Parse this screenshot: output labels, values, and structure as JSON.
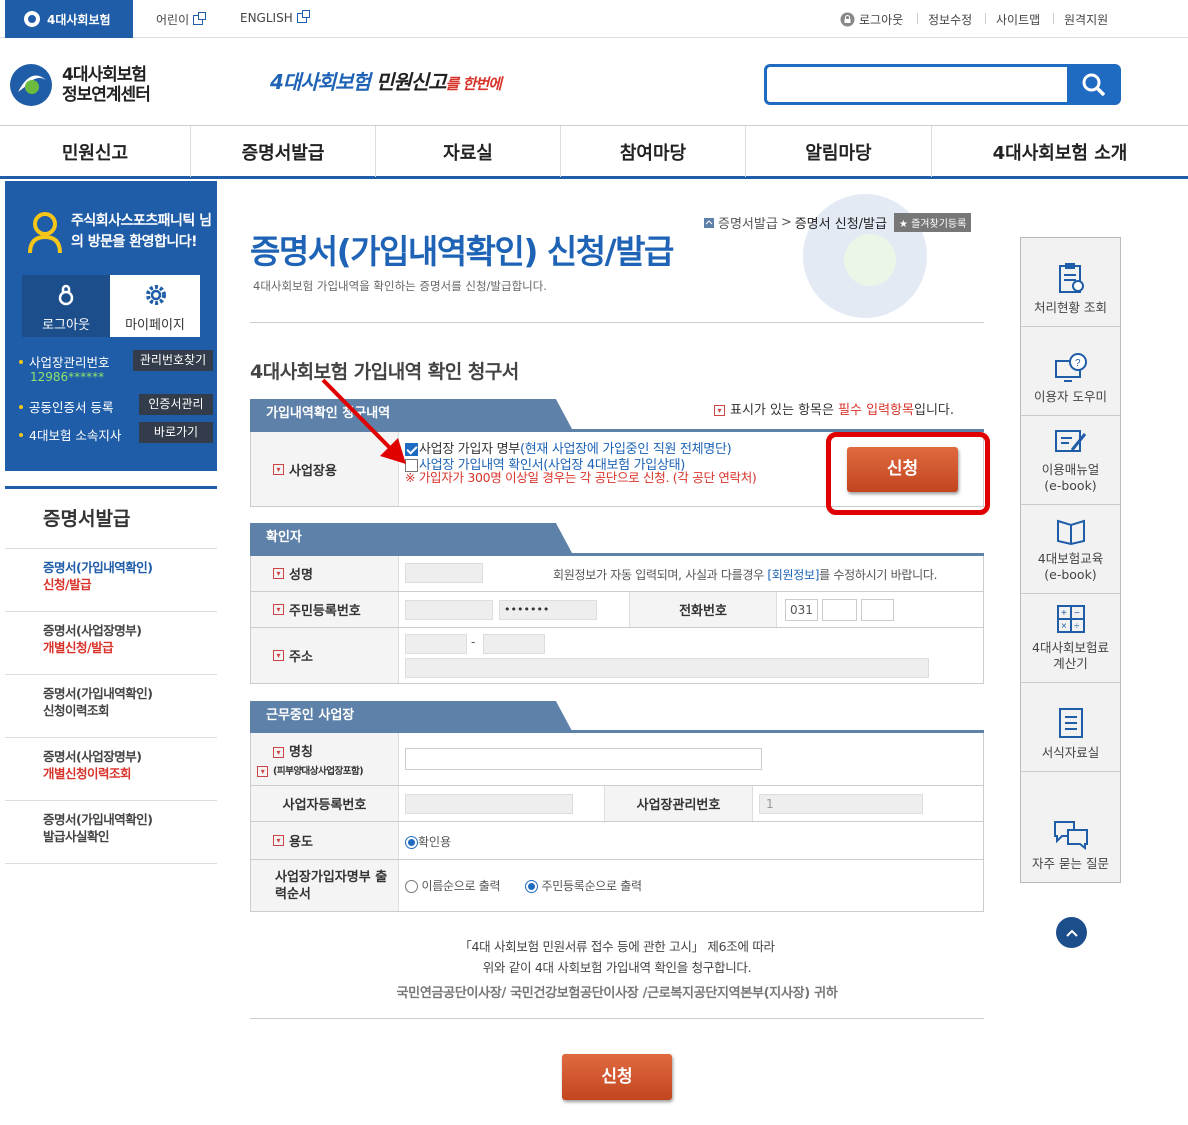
{
  "topbar": {
    "brand": "4대사회보험",
    "kids": "어린이",
    "english": "ENGLISH",
    "logout": "로그아웃",
    "edit_info": "정보수정",
    "sitemap": "사이트맵",
    "remote": "원격지원"
  },
  "header": {
    "logo_line1": "4대사회보험",
    "logo_line2": "정보연계센터",
    "slogan_a": "4대사회보험",
    "slogan_b": " 민원신고",
    "slogan_c": "를 한번에",
    "search_placeholder": ""
  },
  "gnb": [
    "민원신고",
    "증명서발급",
    "자료실",
    "참여마당",
    "알림마당",
    "4대사회보험 소개"
  ],
  "profile": {
    "name": "주식회사스포츠패니틱 님의 방문을 환영합니다!",
    "logout": "로그아웃",
    "mypage": "마이페이지",
    "biz_no_label": "사업장관리번호",
    "biz_no_value": "12986******",
    "find_btn": "관리번호찾기",
    "cert_label": "공동인증서 등록",
    "cert_btn": "인증서관리",
    "branch_label": "4대보험 소속지사",
    "branch_btn": "바로가기"
  },
  "leftmenu": {
    "title": "증명서발급",
    "items": [
      {
        "l1": "증명서(가입내역확인)",
        "l2": "신청/발급"
      },
      {
        "l1": "증명서(사업장명부)",
        "l2": "개별신청/발급"
      },
      {
        "l1": "증명서(가입내역확인)",
        "l2": "신청이력조회"
      },
      {
        "l1": "증명서(사업장명부)",
        "l2": "개별신청이력조회"
      },
      {
        "l1": "증명서(가입내역확인)",
        "l2": "발급사실확인"
      }
    ]
  },
  "breadcrumb": {
    "a": "증명서발급",
    "b": "증명서 신청/발급",
    "fav": "즐겨찾기등록"
  },
  "page": {
    "title": "증명서(가입내역확인) 신청/발급",
    "desc": "4대사회보험 가입내역을 확인하는 증명서를 신청/발급합니다.",
    "form_title": "4대사회보험 가입내역 확인 청구서",
    "req_note_a": "표시가 있는 항목은 ",
    "req_note_b": "필수 입력항목",
    "req_note_c": "입니다."
  },
  "sec1": {
    "tab": "가입내역확인 청구내역",
    "label": "사업장용",
    "opt1_a": "사업장 가입자 명부",
    "opt1_b": "(현재 사업장에 가입중인 직원 전체명단)",
    "opt2": "사업장 가입내역 확인서(사업장 4대보험 가입상태)",
    "warn": "※ 가입자가 300명 이상일 경우는 각 공단으로 신청. (각 공단 연락처)",
    "apply": "신청"
  },
  "sec2": {
    "tab": "확인자",
    "name_label": "성명",
    "notice_a": "회원정보가 자동 입력되며, 사실과 다를경우 ",
    "notice_b": "[회원정보]",
    "notice_c": "를 수정하시기 바랍니다.",
    "rrn_label": "주민등록번호",
    "rrn_masked": "•••••••",
    "phone_label": "전화번호",
    "phone_1": "031",
    "addr_label": "주소",
    "dash": "-"
  },
  "sec3": {
    "tab": "근무중인 사업장",
    "name_label": "명칭",
    "name_sub": "(피부양대상사업장포함)",
    "bizreg_label": "사업자등록번호",
    "bizmgmt_label": "사업장관리번호",
    "bizmgmt_value": "1",
    "use_label": "용도",
    "use_value": "확인용",
    "order_label": "사업장가입자명부 출력순서",
    "order_opt1": "이름순으로 출력",
    "order_opt2": "주민등록순으로 출력"
  },
  "footer_text": {
    "l1": "「4대 사회보험 민원서류 접수 등에 관한 고시」 제6조에 따라",
    "l2": "위와 같이 4대 사회보험 가입내역 확인을 청구합니다.",
    "l3": "국민연금공단이사장/ 국민건강보험공단이사장 /근로복지공단지역본부(지사장) 귀하",
    "apply": "신청"
  },
  "quick": [
    {
      "label": "처리현황 조회"
    },
    {
      "label": "이용자 도우미"
    },
    {
      "label": "이용매뉴얼\n(e-book)"
    },
    {
      "label": "4대보험교육\n(e-book)"
    },
    {
      "label": "4대사회보험료\n계산기"
    },
    {
      "label": "서식자료실"
    },
    {
      "label": "자주 묻는 질문"
    }
  ],
  "colors": {
    "brand_blue": "#1f5da8",
    "accent_red": "#d9342b",
    "apply_orange": "#c24520",
    "highlight": "#e00000"
  }
}
